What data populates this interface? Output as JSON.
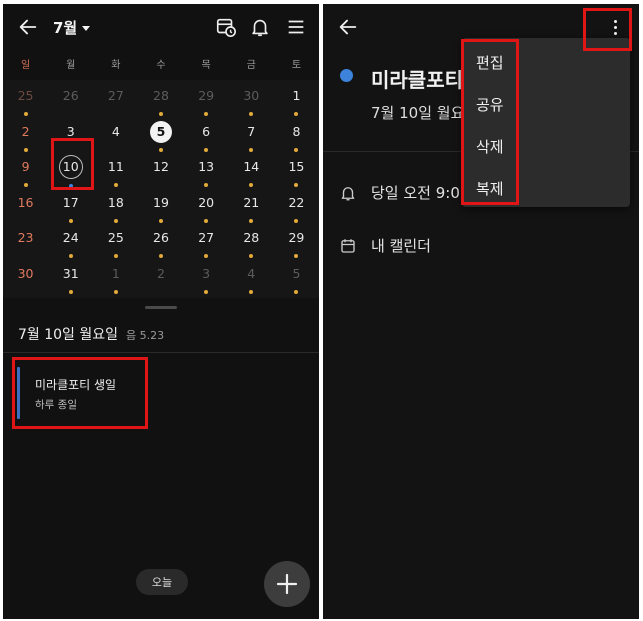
{
  "colors": {
    "background": "#111111",
    "sunday": "#e07a5f",
    "event_dot": "#e3a93a",
    "event_blue": "#3d83db",
    "highlight": "#e01515"
  },
  "left": {
    "header": {
      "month": "7월",
      "icons": [
        "back-arrow-icon",
        "calendar-clock-icon",
        "bell-icon",
        "menu-icon"
      ]
    },
    "weekdays": [
      "일",
      "월",
      "화",
      "수",
      "목",
      "금",
      "토"
    ],
    "weeks": [
      [
        {
          "n": "25",
          "dim": true,
          "dot": true
        },
        {
          "n": "26",
          "dim": true
        },
        {
          "n": "27",
          "dim": true
        },
        {
          "n": "28",
          "dim": true,
          "dot": true
        },
        {
          "n": "29",
          "dim": true,
          "dot": true
        },
        {
          "n": "30",
          "dim": true,
          "dot": true
        },
        {
          "n": "1",
          "dot": true
        }
      ],
      [
        {
          "n": "2",
          "dot": true
        },
        {
          "n": "3"
        },
        {
          "n": "4"
        },
        {
          "n": "5",
          "today": true,
          "dot": true
        },
        {
          "n": "6",
          "dot": true
        },
        {
          "n": "7",
          "dot": true
        },
        {
          "n": "8",
          "dot": true
        }
      ],
      [
        {
          "n": "9",
          "dot": true
        },
        {
          "n": "10",
          "selected": true,
          "dot": "blue"
        },
        {
          "n": "11",
          "dot": true
        },
        {
          "n": "12"
        },
        {
          "n": "13",
          "dot": true
        },
        {
          "n": "14",
          "dot": true
        },
        {
          "n": "15",
          "dot": true
        }
      ],
      [
        {
          "n": "16"
        },
        {
          "n": "17",
          "dot": true
        },
        {
          "n": "18",
          "dot": true
        },
        {
          "n": "19",
          "dot": true
        },
        {
          "n": "20",
          "dot": true
        },
        {
          "n": "21",
          "dot": true
        },
        {
          "n": "22",
          "dot": true
        }
      ],
      [
        {
          "n": "23"
        },
        {
          "n": "24",
          "dot": true
        },
        {
          "n": "25",
          "dot": true
        },
        {
          "n": "26",
          "dot": true
        },
        {
          "n": "27",
          "dot": true
        },
        {
          "n": "28",
          "dot": true
        },
        {
          "n": "29",
          "dot": true
        }
      ],
      [
        {
          "n": "30"
        },
        {
          "n": "31",
          "dot": true
        },
        {
          "n": "1",
          "dim": true,
          "dot": true
        },
        {
          "n": "2",
          "dim": true
        },
        {
          "n": "3",
          "dim": true,
          "dot": true
        },
        {
          "n": "4",
          "dim": true,
          "dot": true
        },
        {
          "n": "5",
          "dim": true,
          "dot": true
        }
      ]
    ],
    "selected_date": "7월 10일 월요일",
    "lunar": "음 5.23",
    "event": {
      "title": "미라클포티 생일",
      "subtitle": "하루 종일"
    },
    "today_button": "오늘",
    "fab_icon": "plus-icon"
  },
  "right": {
    "title": "미라클포티",
    "date_line": "7월 10일 월요",
    "reminder": "당일 오전 9:0",
    "calendar": "내 캘린더",
    "menu": [
      "편집",
      "공유",
      "삭제",
      "복제"
    ]
  }
}
